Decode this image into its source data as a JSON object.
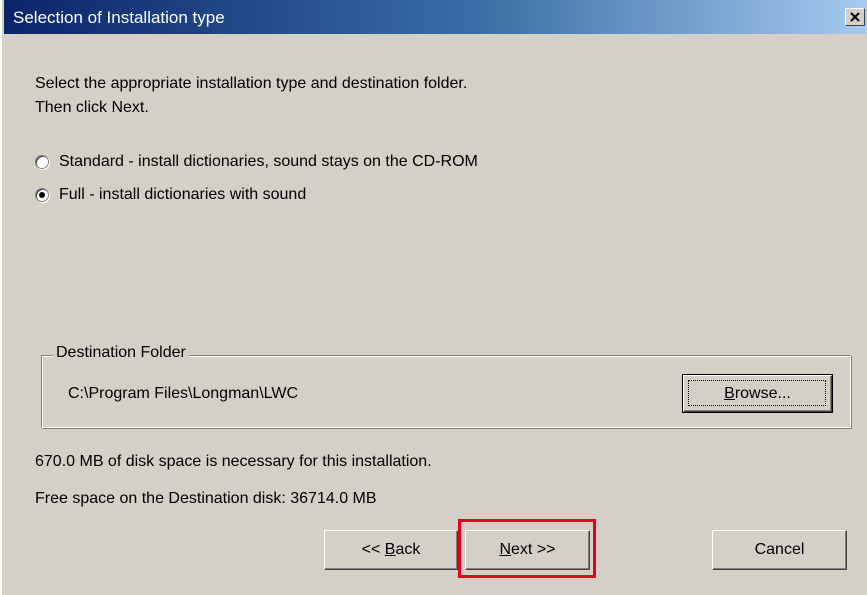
{
  "window": {
    "title": "Selection of Installation type"
  },
  "instructions": {
    "line1": "Select the appropriate installation type and destination folder.",
    "line2": "Then click Next."
  },
  "install_options": [
    {
      "label": "Standard - install dictionaries, sound stays on the CD-ROM",
      "selected": false
    },
    {
      "label": "Full - install dictionaries with sound",
      "selected": true
    }
  ],
  "destination": {
    "legend": "Destination Folder",
    "path": "C:\\Program Files\\Longman\\LWC",
    "browse_label_rest": "rowse...",
    "browse_mnemonic": "B"
  },
  "disk_info": {
    "required": "670.0 MB of disk space is necessary for this installation.",
    "free": "Free space on the Destination disk: 36714.0 MB"
  },
  "buttons": {
    "back_prefix": "<< ",
    "back_mnemonic": "B",
    "back_rest": "ack",
    "next_mnemonic": "N",
    "next_rest": "ext >>",
    "cancel": "Cancel"
  },
  "colors": {
    "dialog_bg": "#d4d0c8",
    "titlebar_start": "#0a246a",
    "titlebar_end": "#a6caf0",
    "highlight": "#e8001a"
  }
}
